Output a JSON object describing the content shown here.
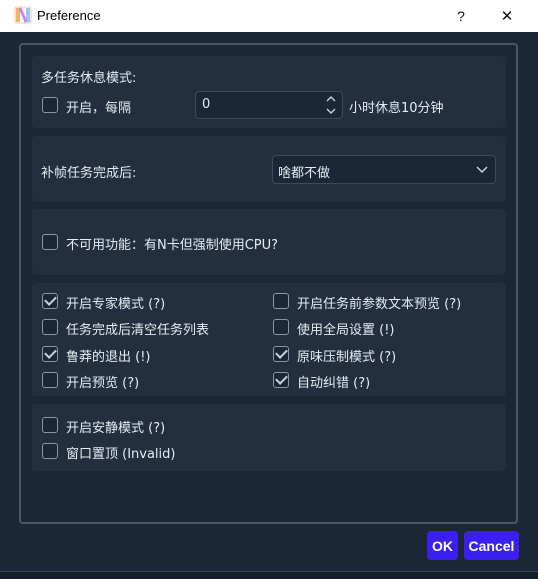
{
  "window": {
    "title": "Preference",
    "help_label": "?",
    "close_label": "✕"
  },
  "rest_mode": {
    "heading": "多任务休息模式:",
    "enable_label": "开启，每隔",
    "enabled": false,
    "interval_value": "0",
    "suffix": "小时休息10分钟"
  },
  "frame_task": {
    "label": "补帧任务完成后:",
    "selected": "啥都不做"
  },
  "unavailable": {
    "label": "不可用功能：有N卡但强制使用CPU?",
    "checked": false
  },
  "options": [
    {
      "label": "开启专家模式 (?)",
      "checked": true
    },
    {
      "label": "开启任务前参数文本预览 (?)",
      "checked": false
    },
    {
      "label": "任务完成后清空任务列表",
      "checked": false
    },
    {
      "label": "使用全局设置 (!)",
      "checked": false
    },
    {
      "label": "鲁莽的退出 (!)",
      "checked": true
    },
    {
      "label": "原味压制模式 (?)",
      "checked": true
    },
    {
      "label": "开启预览 (?)",
      "checked": false
    },
    {
      "label": "自动纠错 (?)",
      "checked": true
    }
  ],
  "extra": [
    {
      "label": "开启安静模式 (?)",
      "checked": false
    },
    {
      "label": "窗口置顶 (Invalid)",
      "checked": false
    }
  ],
  "buttons": {
    "ok": "OK",
    "cancel": "Cancel"
  },
  "colors": {
    "accent": "#3b1ff0",
    "background": "#1b2736",
    "panel": "#232f3e"
  }
}
